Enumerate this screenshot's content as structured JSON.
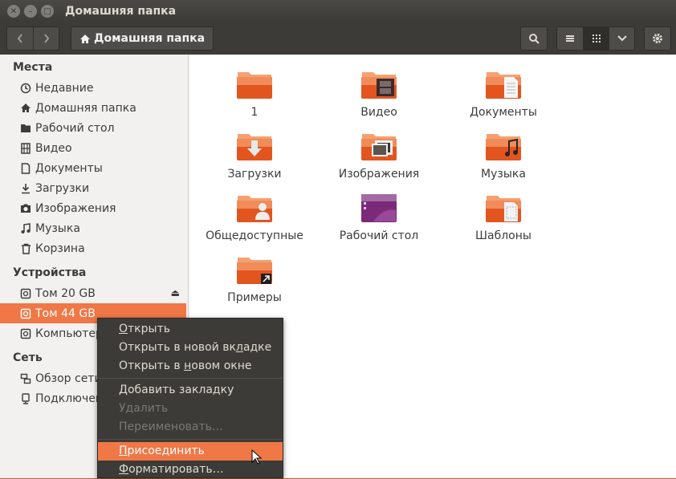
{
  "window": {
    "title": "Домашняя папка",
    "close_glyph": "✕",
    "min_glyph": "–",
    "max_glyph": "□"
  },
  "toolbar": {
    "back_icon": "chevron-left-icon",
    "forward_icon": "chevron-right-icon",
    "breadcrumb": "Домашняя папка",
    "search_icon": "search-icon",
    "list_view_icon": "list-icon",
    "grid_view_icon": "grid-icon",
    "view_menu_icon": "chevron-down-icon",
    "settings_icon": "gear-icon"
  },
  "sidebar": {
    "places_header": "Места",
    "places": [
      {
        "label": "Недавние",
        "icon": "clock-icon"
      },
      {
        "label": "Домашняя папка",
        "icon": "home-icon"
      },
      {
        "label": "Рабочий стол",
        "icon": "desktop-icon"
      },
      {
        "label": "Видео",
        "icon": "film-icon"
      },
      {
        "label": "Документы",
        "icon": "document-icon"
      },
      {
        "label": "Загрузки",
        "icon": "download-icon"
      },
      {
        "label": "Изображения",
        "icon": "camera-icon"
      },
      {
        "label": "Музыка",
        "icon": "music-icon"
      },
      {
        "label": "Корзина",
        "icon": "trash-icon"
      }
    ],
    "devices_header": "Устройства",
    "devices": [
      {
        "label": "Том 20 GB",
        "icon": "drive-icon",
        "eject": "⏏"
      },
      {
        "label": "Том 44 GB",
        "icon": "drive-icon"
      },
      {
        "label": "Компьютер",
        "icon": "drive-icon"
      }
    ],
    "network_header": "Сеть",
    "network": [
      {
        "label": "Обзор сети",
        "icon": "network-icon"
      },
      {
        "label": "Подключение",
        "icon": "server-icon"
      }
    ]
  },
  "files": [
    {
      "name": "1",
      "emblem": "none"
    },
    {
      "name": "Видео",
      "emblem": "film"
    },
    {
      "name": "Документы",
      "emblem": "document"
    },
    {
      "name": "Загрузки",
      "emblem": "download"
    },
    {
      "name": "Изображения",
      "emblem": "pictures"
    },
    {
      "name": "Музыка",
      "emblem": "music"
    },
    {
      "name": "Общедоступные",
      "emblem": "person"
    },
    {
      "name": "Рабочий стол",
      "emblem": "desktop"
    },
    {
      "name": "Шаблоны",
      "emblem": "template"
    },
    {
      "name": "Примеры",
      "emblem": "link"
    }
  ],
  "context_menu": {
    "items": [
      {
        "label": "Открыть",
        "underline": "О",
        "rest": "ткрыть"
      },
      {
        "label": "Открыть в новой вкладке",
        "pre": "Открыть в новой вк",
        "underline": "л",
        "rest": "адке"
      },
      {
        "label": "Открыть в новом окне",
        "pre": "Открыть в ",
        "underline": "н",
        "rest": "овом окне"
      },
      {
        "label": "Добавить закладку",
        "underline": "Д",
        "rest": "обавить закладку"
      },
      {
        "label": "Удалить"
      },
      {
        "label": "Переименовать…"
      },
      {
        "label": "Присоединить",
        "underline": "П",
        "rest": "рисоединить"
      },
      {
        "label": "Форматировать…",
        "underline": "Ф",
        "rest": "орматировать…"
      }
    ]
  },
  "colors": {
    "accent": "#f07746",
    "titlebar": "#3c3b37",
    "menu_bg": "#3c3b37",
    "folder_top": "#f08c5a",
    "folder_body": "#e2551f"
  }
}
